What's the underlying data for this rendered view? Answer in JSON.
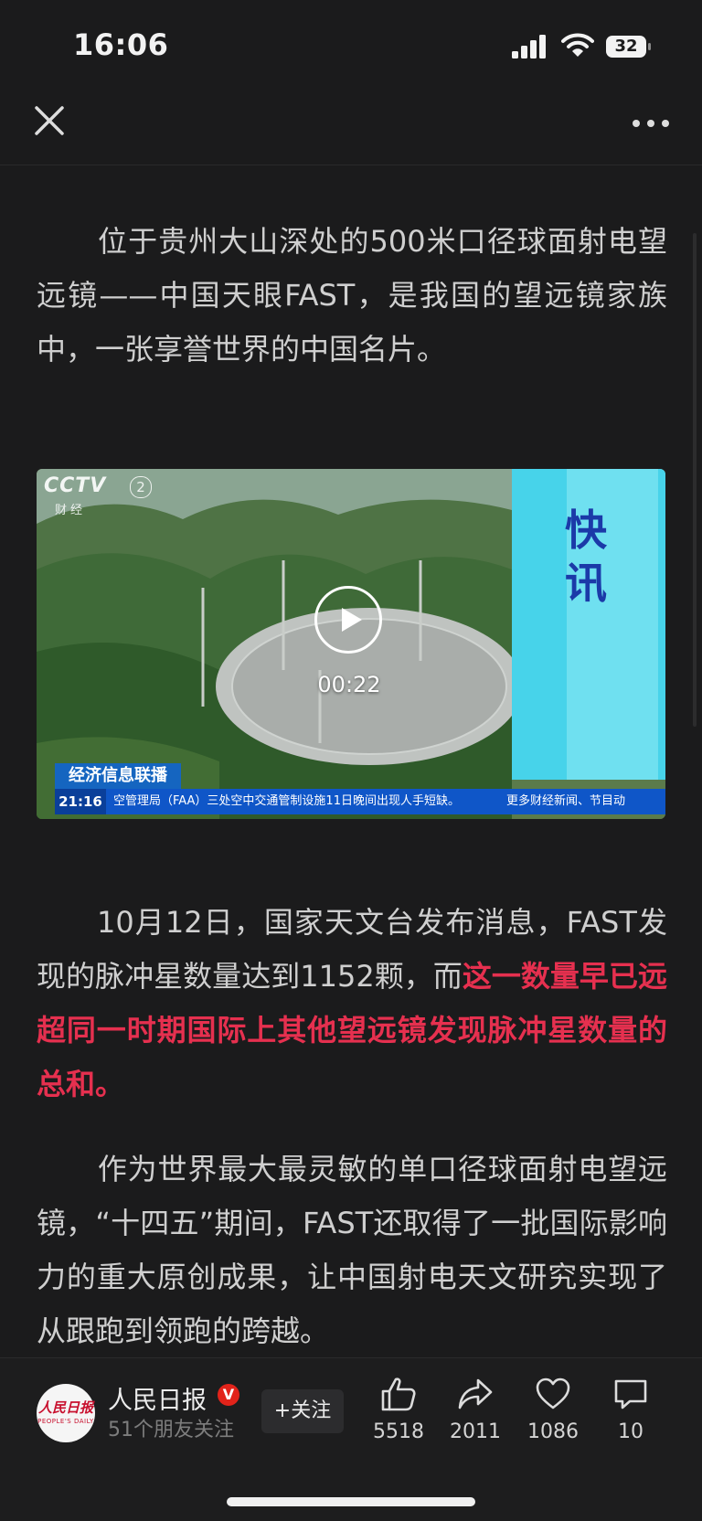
{
  "status_bar": {
    "time": "16:06",
    "battery": "32",
    "icons": [
      "signal-icon",
      "wifi-icon",
      "battery-icon"
    ]
  },
  "nav": {
    "close_icon": "close-icon",
    "more_icon": "more-icon"
  },
  "article": {
    "paragraph1": "位于贵州大山深处的500米口径球面射电望远镜——中国天眼FAST，是我国的望远镜家族中，一张享誉世界的中国名片。",
    "paragraph2_plain": "10月12日，国家天文台发布消息，FAST发现的脉冲星数量达到1152颗，而",
    "paragraph2_highlight": "这一数量早已远超同一时期国际上其他望远镜发现脉冲星数量的总和。",
    "paragraph3": "作为世界最大最灵敏的单口径球面射电望远镜，“十四五”期间，FAST还取得了一批国际影响力的重大原创成果，让中国射电天文研究实现了从跟跑到领跑的跨越。",
    "highlight_color": "#e6304f"
  },
  "video": {
    "duration": "00:22",
    "channel_logo": "CCTV",
    "channel_number": "2",
    "channel_sub": "财经",
    "flash_label": "快讯",
    "program_tag": "经济信息联播",
    "ticker_time": "21:16",
    "ticker_text": "空管理局（FAA）三处空中交通管制设施11日晚间出现人手短缺。",
    "ticker_text_right": "更多财经新闻、节目动",
    "play_icon": "play-icon"
  },
  "footer": {
    "avatar_text": "人民日报",
    "avatar_subtext": "PEOPLE'S DAILY",
    "account_name": "人民日报",
    "verified": "V",
    "friends": "51个朋友关注",
    "follow_label": "+关注",
    "actions": [
      {
        "icon": "thumbs-up-icon",
        "count": "5518"
      },
      {
        "icon": "share-icon",
        "count": "2011"
      },
      {
        "icon": "heart-icon",
        "count": "1086"
      },
      {
        "icon": "comment-icon",
        "count": "10"
      }
    ]
  }
}
